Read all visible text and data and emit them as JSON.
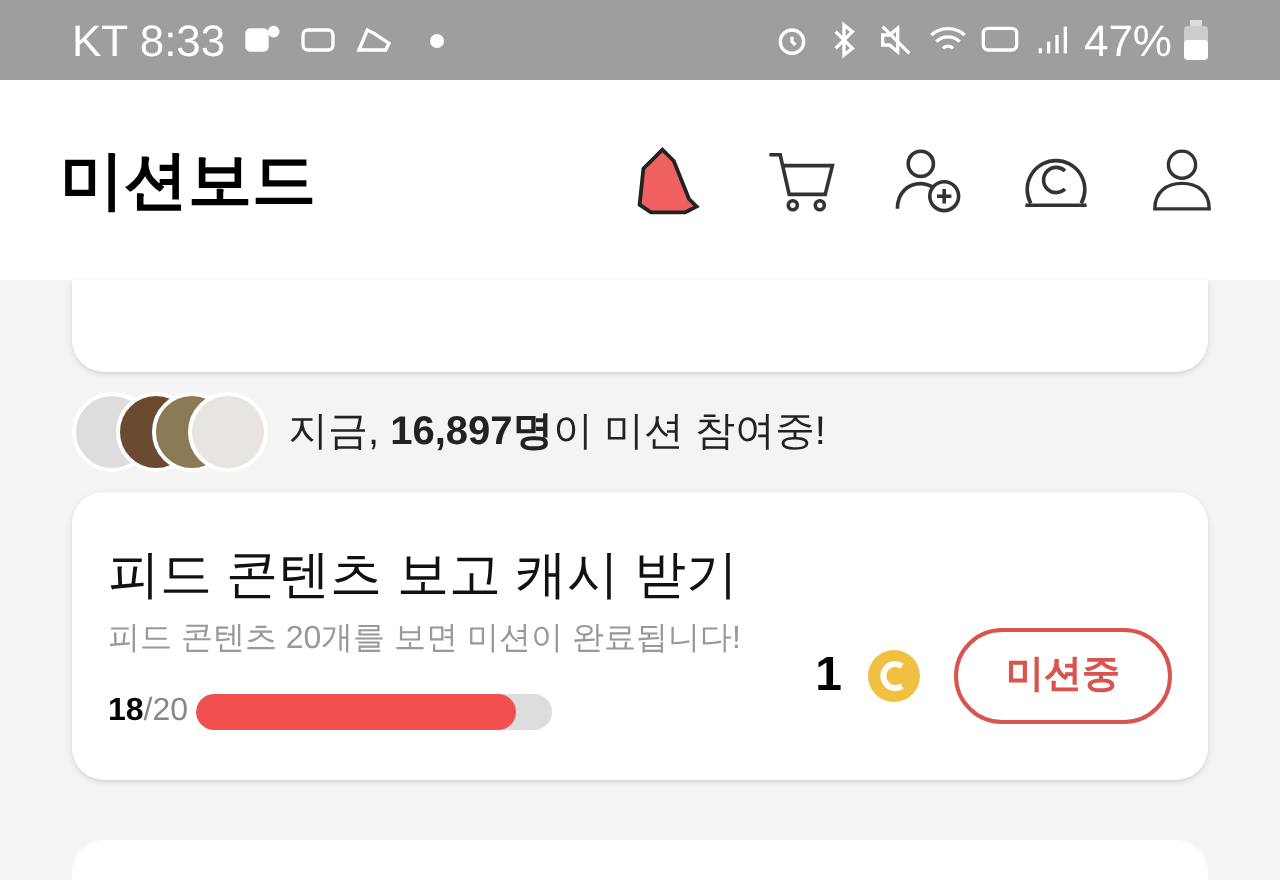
{
  "status_bar": {
    "carrier_time": "KT 8:33",
    "battery": "47%"
  },
  "header": {
    "title": "미션보드"
  },
  "participants": {
    "text": "지금, **16,897명**이 미션 참여중!"
  },
  "mission": {
    "title": "피드 콘텐츠 보고 캐시 받기",
    "description": "피드 콘텐츠 20개를 보면 미션이 완료됩니다!",
    "reward": "1",
    "button": "미션중",
    "progress_done": "18",
    "progress_total": "/20",
    "level": 0.9
  }
}
